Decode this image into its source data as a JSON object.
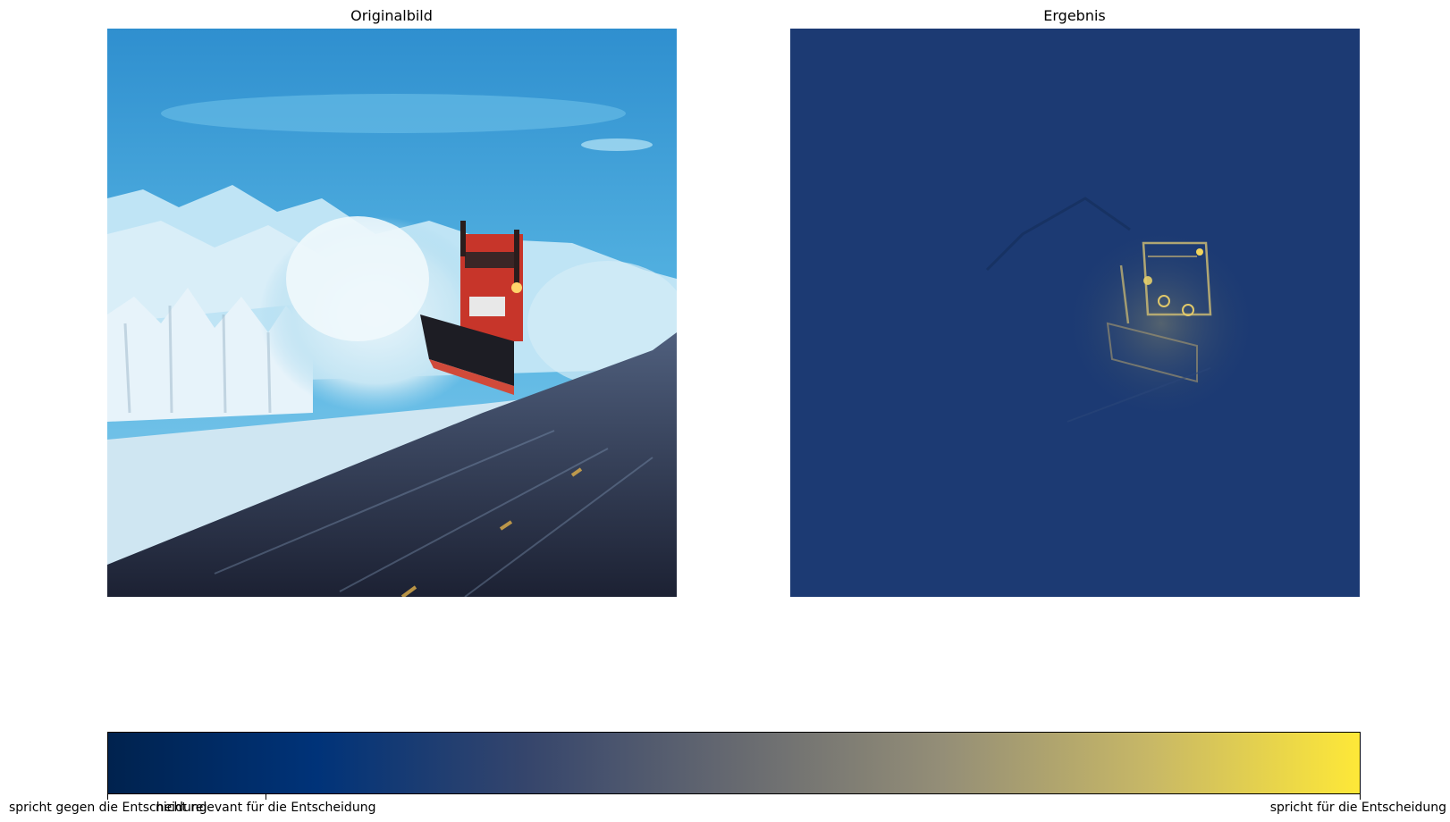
{
  "panels": {
    "left": {
      "title": "Originalbild"
    },
    "right": {
      "title": "Ergebnis"
    }
  },
  "colorbar": {
    "colormap": "cividis",
    "stops": [
      "#00224e",
      "#003379",
      "#35456c",
      "#666970",
      "#948e77",
      "#c8b866",
      "#fee838"
    ],
    "ticks": [
      {
        "label": "spricht gegen die Entscheidung"
      },
      {
        "label": "nicht relevant für die Entscheidung"
      },
      {
        "label": "spricht für die Entscheidung"
      }
    ]
  }
}
